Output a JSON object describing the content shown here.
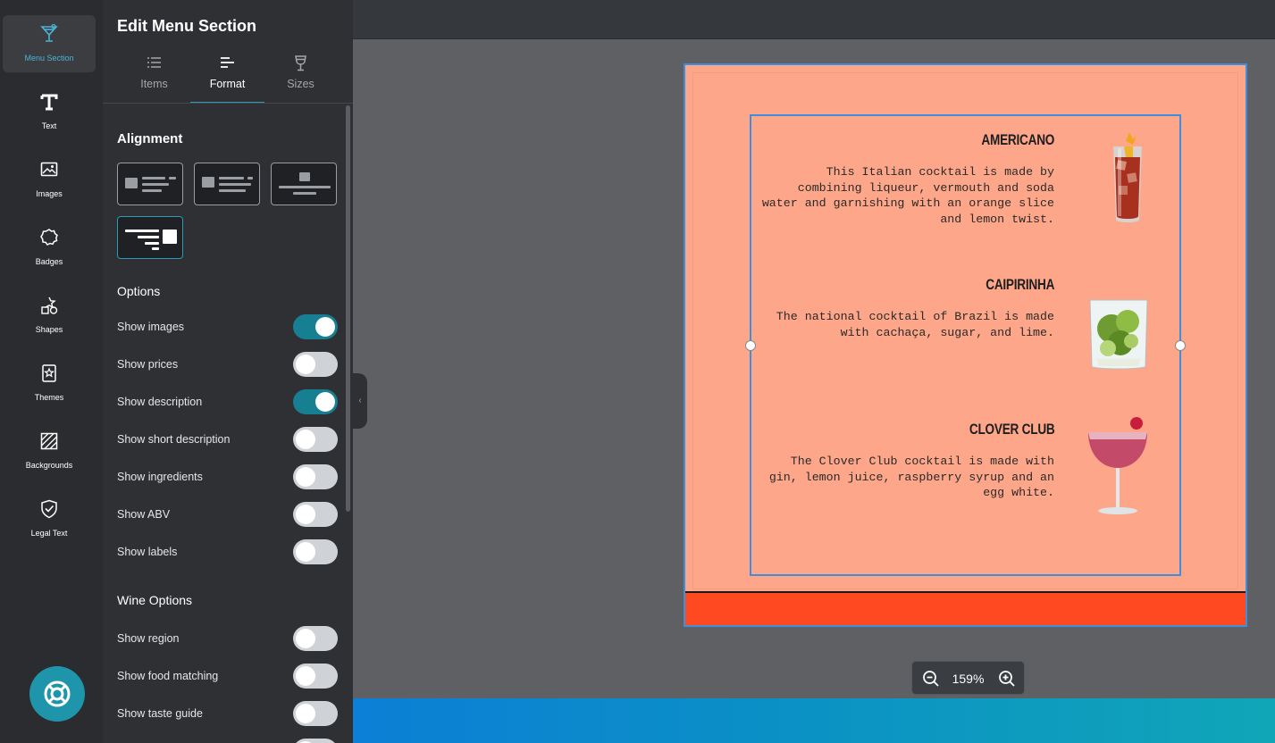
{
  "rail": {
    "items": [
      {
        "label": "Menu Section",
        "icon": "cocktail-glass-icon",
        "active": true
      },
      {
        "label": "Text",
        "icon": "text-t-icon"
      },
      {
        "label": "Images",
        "icon": "image-icon"
      },
      {
        "label": "Badges",
        "icon": "badge-icon"
      },
      {
        "label": "Shapes",
        "icon": "shapes-icon"
      },
      {
        "label": "Themes",
        "icon": "themes-icon"
      },
      {
        "label": "Backgrounds",
        "icon": "backgrounds-hatch-icon"
      },
      {
        "label": "Legal Text",
        "icon": "shield-check-icon"
      }
    ],
    "help_icon": "lifebuoy-icon"
  },
  "panel": {
    "title": "Edit Menu Section",
    "tabs": [
      {
        "label": "Items",
        "icon": "list-icon"
      },
      {
        "label": "Format",
        "icon": "format-align-icon",
        "active": true
      },
      {
        "label": "Sizes",
        "icon": "wine-glass-icon"
      }
    ],
    "alignment_title": "Alignment",
    "options_title": "Options",
    "options": [
      {
        "label": "Show images",
        "on": true
      },
      {
        "label": "Show prices",
        "on": false
      },
      {
        "label": "Show description",
        "on": true
      },
      {
        "label": "Show short description",
        "on": false
      },
      {
        "label": "Show ingredients",
        "on": false
      },
      {
        "label": "Show ABV",
        "on": false
      },
      {
        "label": "Show labels",
        "on": false
      }
    ],
    "wine_options_title": "Wine Options",
    "wine_options": [
      {
        "label": "Show region",
        "on": false
      },
      {
        "label": "Show food matching",
        "on": false
      },
      {
        "label": "Show taste guide",
        "on": false
      }
    ]
  },
  "menu": {
    "items": [
      {
        "name": "AMERICANO",
        "description": "This Italian cocktail is made by combining liqueur, vermouth and soda water and garnishing with an orange slice and lemon twist.",
        "image": "americano-glass"
      },
      {
        "name": "CAIPIRINHA",
        "description": "The national cocktail of Brazil is made with cachaça, sugar, and lime.",
        "image": "caipirinha-glass"
      },
      {
        "name": "CLOVER CLUB",
        "description": "The Clover Club cocktail is made with gin, lemon juice, raspberry syrup and an egg white.",
        "image": "clover-club-glass"
      }
    ],
    "colors": {
      "board": "#fda689",
      "footer": "#ff4a21",
      "selection": "#3d8fde"
    }
  },
  "zoom": {
    "value": "159%"
  }
}
